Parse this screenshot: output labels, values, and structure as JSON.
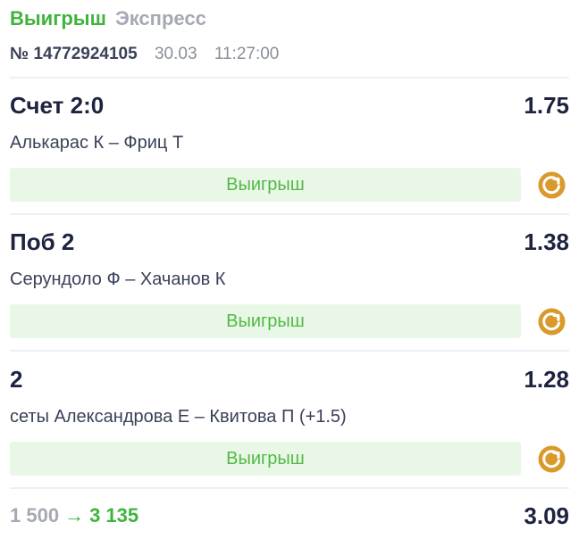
{
  "header": {
    "status": "Выигрыш",
    "bet_type": "Экспресс",
    "number": "№ 14772924105",
    "date": "30.03",
    "time": "11:27:00"
  },
  "events": [
    {
      "market": "Счет 2:0",
      "odds": "1.75",
      "match": "Алькарас К – Фриц Т",
      "result": "Выигрыш",
      "icon": "cashout-icon"
    },
    {
      "market": "Поб 2",
      "odds": "1.38",
      "match": "Серундоло Ф – Хачанов К",
      "result": "Выигрыш",
      "icon": "cashout-icon"
    },
    {
      "market": "2",
      "odds": "1.28",
      "match": "сеты Александрова Е – Квитова П (+1.5)",
      "result": "Выигрыш",
      "icon": "cashout-icon"
    }
  ],
  "footer": {
    "stake": "1 500",
    "arrow": "→",
    "payout": "3 135",
    "total_odds": "3.09"
  },
  "colors": {
    "win_green": "#3fb43c",
    "result_bg": "#e9f8e6",
    "icon_orange": "#d99a2b",
    "text_dark": "#1d2340",
    "muted_gray": "#a5a9b3"
  }
}
